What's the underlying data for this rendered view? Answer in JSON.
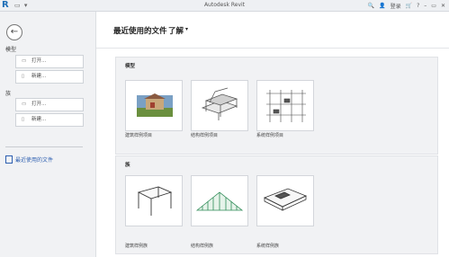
{
  "window": {
    "title": "Autodesk Revit",
    "logo": "R"
  },
  "titlebar_right": {
    "user_label": "登录"
  },
  "sidebar": {
    "back_icon": "back-arrow-icon",
    "models_label": "模型",
    "families_label": "族",
    "open_label": "打开...",
    "new_label": "新建...",
    "recent_label": "最近使用的文件"
  },
  "header": {
    "title": "最近使用的文件",
    "learn": "了解"
  },
  "models_section": {
    "title": "模型",
    "items": [
      {
        "caption": "建筑样例项目"
      },
      {
        "caption": "结构样例项目"
      },
      {
        "caption": "系统样例项目"
      }
    ]
  },
  "families_section": {
    "title": "族",
    "items": [
      {
        "caption": "建筑样例族"
      },
      {
        "caption": "结构样例族"
      },
      {
        "caption": "系统样例族"
      }
    ]
  }
}
